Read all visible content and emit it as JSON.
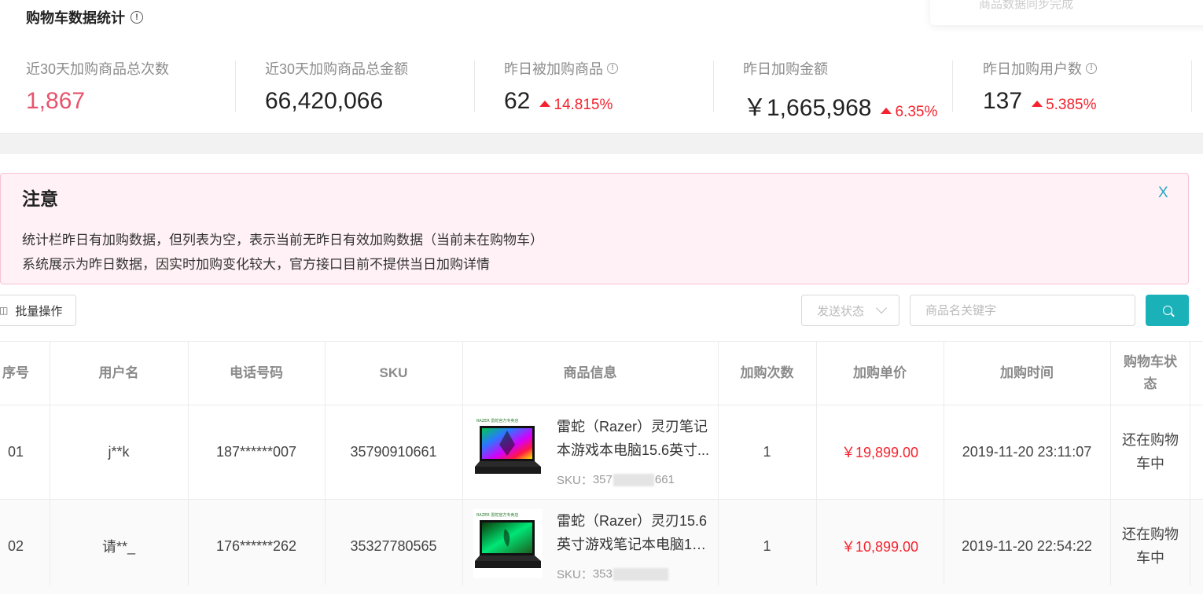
{
  "stats": {
    "title": "购物车数据统计",
    "info_glyph": "!",
    "sync_status": "商品数据同步完成",
    "items": [
      {
        "label": "近30天加购商品总次数",
        "value": "1,867",
        "change": "",
        "has_info": false
      },
      {
        "label": "近30天加购商品总金额",
        "value": "66,420,066",
        "change": "",
        "has_info": false
      },
      {
        "label": "昨日被加购商品",
        "value": "62",
        "change": "14.815%",
        "has_info": true
      },
      {
        "label": "昨日加购金额",
        "value": "￥1,665,968",
        "change": "6.35%",
        "has_info": false
      },
      {
        "label": "昨日加购用户数",
        "value": "137",
        "change": "5.385%",
        "has_info": true
      }
    ]
  },
  "notice": {
    "title": "注意",
    "close_label": "X",
    "lines": [
      "统计栏昨日有加购数据，但列表为空，表示当前无昨日有效加购数据（当前未在购物车）",
      "系统展示为昨日数据，因实时加购变化较大，官方接口目前不提供当日加购详情"
    ]
  },
  "toolbar": {
    "batch_label": "批量操作",
    "status_placeholder": "发送状态",
    "search_placeholder": "商品名关键字"
  },
  "table": {
    "headers": [
      "序号",
      "用户名",
      "电话号码",
      "SKU",
      "商品信息",
      "加购次数",
      "加购单价",
      "加购时间",
      "购物车状态"
    ],
    "rows": [
      {
        "index": "01",
        "username": "j**k",
        "phone": "187******007",
        "sku": "35790910661",
        "product_line1": "雷蛇（Razer）灵刃笔记",
        "product_line2": "本游戏本电脑15.6英寸...",
        "sku_label": "SKU：",
        "sku_prefix": "357",
        "sku_suffix": "661",
        "count": "1",
        "price": "￥19,899.00",
        "time": "2019-11-20 23:11:07",
        "status": "还在购物车中"
      },
      {
        "index": "02",
        "username": "请**_",
        "phone": "176******262",
        "sku": "35327780565",
        "product_line1": "雷蛇（Razer）灵刃15.6",
        "product_line2": "英寸游戏笔记本电脑10...",
        "sku_label": "SKU：",
        "sku_prefix": "353",
        "sku_suffix": "",
        "count": "1",
        "price": "￥10,899.00",
        "time": "2019-11-20 22:54:22",
        "status": "还在购物车中"
      }
    ]
  },
  "colors": {
    "accent": "#1bb1b8",
    "up": "#f5222d",
    "highlight_value": "#e8546c",
    "notice_bg": "#fff1f5"
  }
}
